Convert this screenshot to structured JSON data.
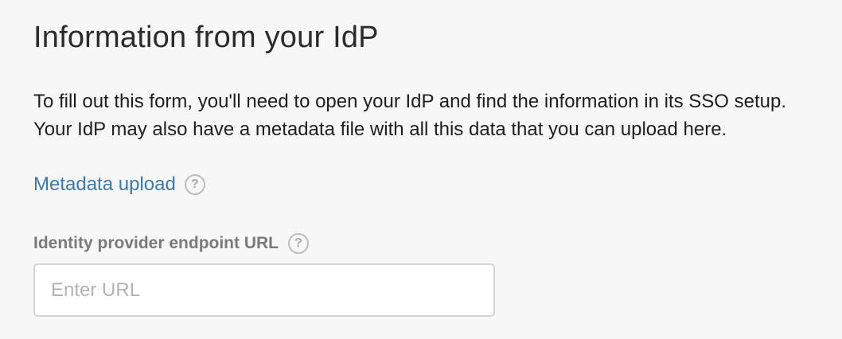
{
  "section": {
    "title": "Information from your IdP",
    "description": "To fill out this form, you'll need to open your IdP and find the information in its SSO setup. Your IdP may also have a metadata file with all this data that you can upload here.",
    "metadata_link": "Metadata upload",
    "help_glyph": "?"
  },
  "fields": {
    "idp_endpoint": {
      "label": "Identity provider endpoint URL",
      "placeholder": "Enter URL",
      "value": ""
    }
  },
  "icons": {
    "help": "question-circle-icon"
  },
  "colors": {
    "background": "#f7f7f7",
    "link": "#3d79a8",
    "label": "#7a7a7a",
    "input_border": "#d4d4d4"
  }
}
